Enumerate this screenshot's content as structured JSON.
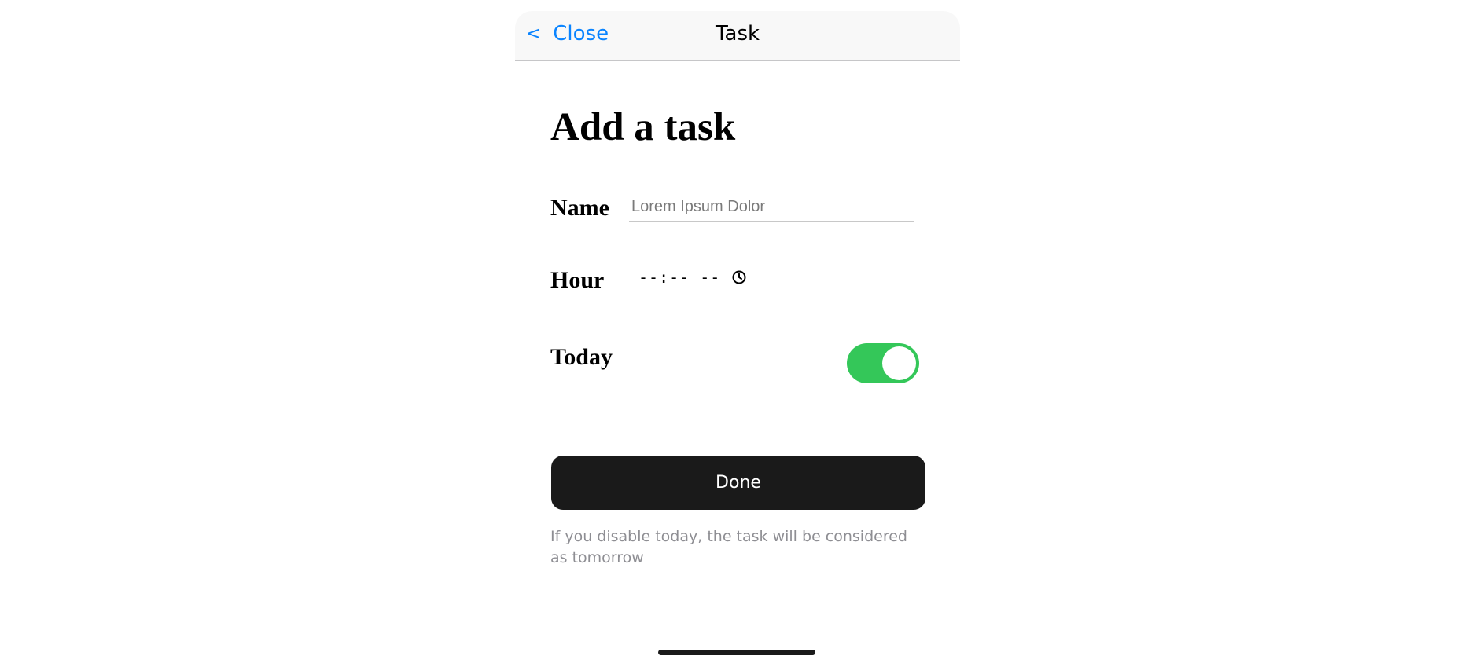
{
  "navbar": {
    "back_chevron": "<",
    "close_label": "Close",
    "title": "Task"
  },
  "form": {
    "heading": "Add a task",
    "name": {
      "label": "Name",
      "placeholder": "Lorem Ipsum Dolor",
      "value": ""
    },
    "hour": {
      "label": "Hour",
      "display": "--:-- --",
      "icon": "clock-icon"
    },
    "today": {
      "label": "Today",
      "enabled": true,
      "on_color": "#34c759"
    },
    "done_label": "Done",
    "hint": "If you disable today, the task will be considered as tomorrow"
  },
  "colors": {
    "accent": "#0a84ff",
    "button_bg": "#1a1a1a",
    "hint": "#8e8e93"
  }
}
